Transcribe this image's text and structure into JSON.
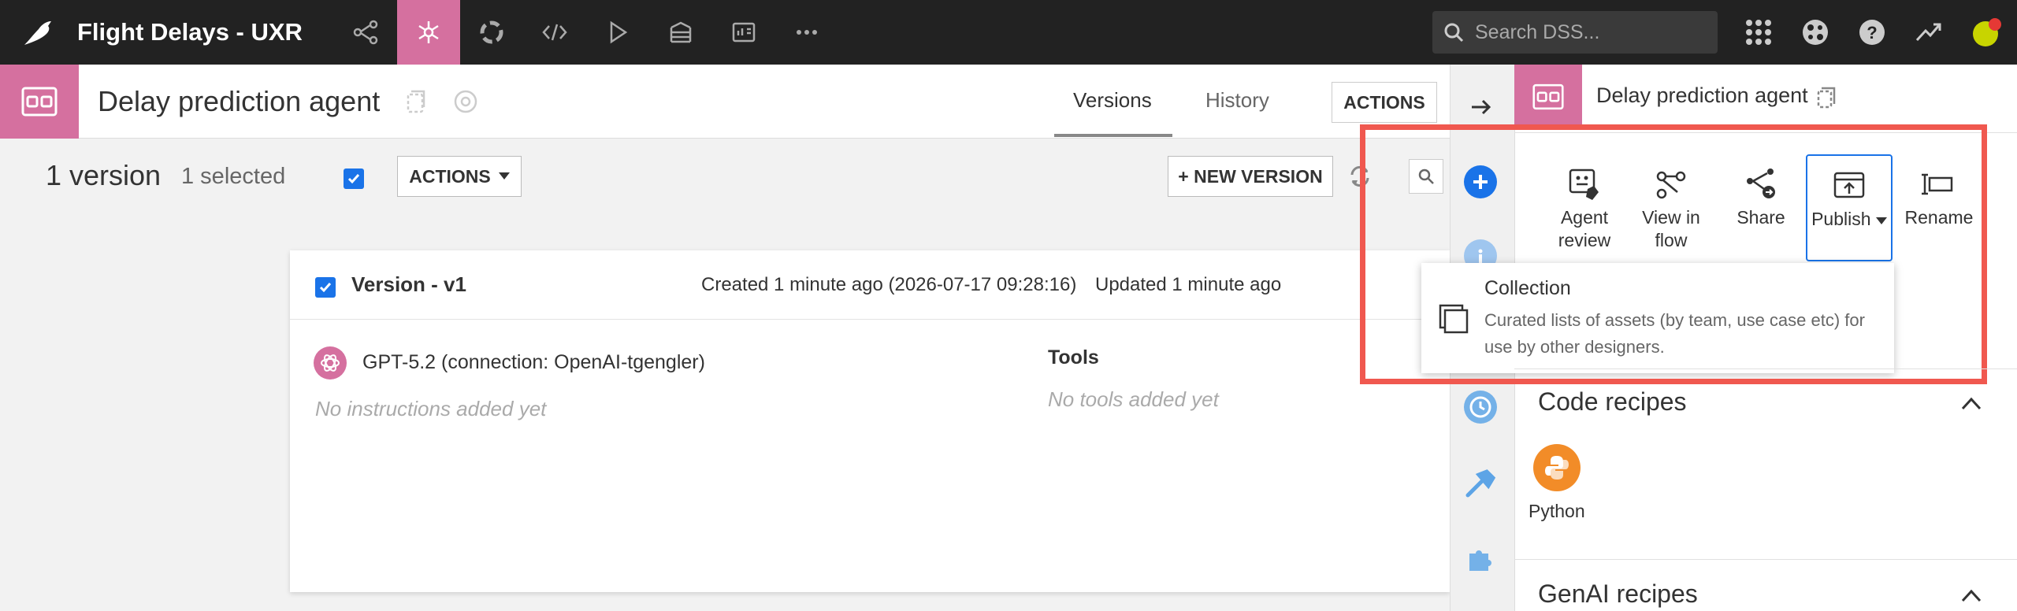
{
  "topbar": {
    "project_title": "Flight Delays - UXR",
    "search_placeholder": "Search DSS...",
    "nav_icons": [
      "flow-icon",
      "agent-icon",
      "lab-icon",
      "code-icon",
      "run-icon",
      "deploy-icon",
      "dashboard-icon",
      "more-icon"
    ]
  },
  "object_header": {
    "title": "Delay prediction agent",
    "tabs": {
      "versions": "Versions",
      "history": "History"
    },
    "actions_label": "ACTIONS"
  },
  "version_toolbar": {
    "count": "1 version",
    "selected": "1 selected",
    "actions_label": "ACTIONS",
    "new_version_label": "+ NEW VERSION"
  },
  "version_card": {
    "title": "Version - v1",
    "created": "Created 1 minute ago (2026-07-17 09:28:16)",
    "updated": "Updated 1 minute ago",
    "model": "GPT-5.2 (connection: OpenAI-tgengler)",
    "no_instructions": "No instructions added yet",
    "tools_title": "Tools",
    "no_tools": "No tools added yet"
  },
  "right_panel": {
    "title": "Delay prediction agent",
    "tools": [
      {
        "label_line1": "Agent",
        "label_line2": "review"
      },
      {
        "label_line1": "View in",
        "label_line2": "flow"
      },
      {
        "label_line1": "Share",
        "label_line2": ""
      },
      {
        "label_line1": "Publish",
        "label_line2": ""
      },
      {
        "label_line1": "Rename",
        "label_line2": ""
      }
    ],
    "popover": {
      "title": "Collection",
      "description": "Curated lists of assets (by team, use case etc) for use by other designers."
    },
    "sections": [
      {
        "title": "Code recipes",
        "items": [
          "Python"
        ]
      },
      {
        "title": "GenAI recipes"
      }
    ]
  },
  "colors": {
    "accent_pink": "#d5709f",
    "topbar_bg": "#222222",
    "primary_blue": "#1a73e8",
    "highlight_red": "#f0584f"
  }
}
